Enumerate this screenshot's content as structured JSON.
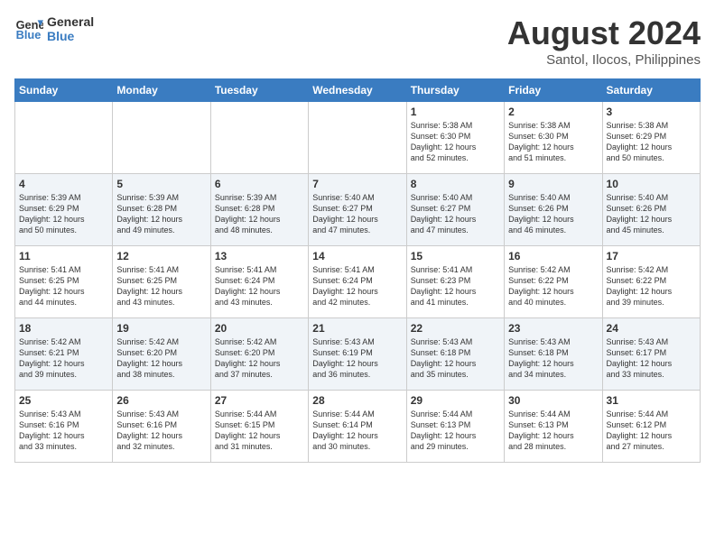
{
  "header": {
    "logo_line1": "General",
    "logo_line2": "Blue",
    "month_year": "August 2024",
    "location": "Santol, Ilocos, Philippines"
  },
  "days_of_week": [
    "Sunday",
    "Monday",
    "Tuesday",
    "Wednesday",
    "Thursday",
    "Friday",
    "Saturday"
  ],
  "weeks": [
    [
      {
        "num": "",
        "detail": ""
      },
      {
        "num": "",
        "detail": ""
      },
      {
        "num": "",
        "detail": ""
      },
      {
        "num": "",
        "detail": ""
      },
      {
        "num": "1",
        "detail": "Sunrise: 5:38 AM\nSunset: 6:30 PM\nDaylight: 12 hours\nand 52 minutes."
      },
      {
        "num": "2",
        "detail": "Sunrise: 5:38 AM\nSunset: 6:30 PM\nDaylight: 12 hours\nand 51 minutes."
      },
      {
        "num": "3",
        "detail": "Sunrise: 5:38 AM\nSunset: 6:29 PM\nDaylight: 12 hours\nand 50 minutes."
      }
    ],
    [
      {
        "num": "4",
        "detail": "Sunrise: 5:39 AM\nSunset: 6:29 PM\nDaylight: 12 hours\nand 50 minutes."
      },
      {
        "num": "5",
        "detail": "Sunrise: 5:39 AM\nSunset: 6:28 PM\nDaylight: 12 hours\nand 49 minutes."
      },
      {
        "num": "6",
        "detail": "Sunrise: 5:39 AM\nSunset: 6:28 PM\nDaylight: 12 hours\nand 48 minutes."
      },
      {
        "num": "7",
        "detail": "Sunrise: 5:40 AM\nSunset: 6:27 PM\nDaylight: 12 hours\nand 47 minutes."
      },
      {
        "num": "8",
        "detail": "Sunrise: 5:40 AM\nSunset: 6:27 PM\nDaylight: 12 hours\nand 47 minutes."
      },
      {
        "num": "9",
        "detail": "Sunrise: 5:40 AM\nSunset: 6:26 PM\nDaylight: 12 hours\nand 46 minutes."
      },
      {
        "num": "10",
        "detail": "Sunrise: 5:40 AM\nSunset: 6:26 PM\nDaylight: 12 hours\nand 45 minutes."
      }
    ],
    [
      {
        "num": "11",
        "detail": "Sunrise: 5:41 AM\nSunset: 6:25 PM\nDaylight: 12 hours\nand 44 minutes."
      },
      {
        "num": "12",
        "detail": "Sunrise: 5:41 AM\nSunset: 6:25 PM\nDaylight: 12 hours\nand 43 minutes."
      },
      {
        "num": "13",
        "detail": "Sunrise: 5:41 AM\nSunset: 6:24 PM\nDaylight: 12 hours\nand 43 minutes."
      },
      {
        "num": "14",
        "detail": "Sunrise: 5:41 AM\nSunset: 6:24 PM\nDaylight: 12 hours\nand 42 minutes."
      },
      {
        "num": "15",
        "detail": "Sunrise: 5:41 AM\nSunset: 6:23 PM\nDaylight: 12 hours\nand 41 minutes."
      },
      {
        "num": "16",
        "detail": "Sunrise: 5:42 AM\nSunset: 6:22 PM\nDaylight: 12 hours\nand 40 minutes."
      },
      {
        "num": "17",
        "detail": "Sunrise: 5:42 AM\nSunset: 6:22 PM\nDaylight: 12 hours\nand 39 minutes."
      }
    ],
    [
      {
        "num": "18",
        "detail": "Sunrise: 5:42 AM\nSunset: 6:21 PM\nDaylight: 12 hours\nand 39 minutes."
      },
      {
        "num": "19",
        "detail": "Sunrise: 5:42 AM\nSunset: 6:20 PM\nDaylight: 12 hours\nand 38 minutes."
      },
      {
        "num": "20",
        "detail": "Sunrise: 5:42 AM\nSunset: 6:20 PM\nDaylight: 12 hours\nand 37 minutes."
      },
      {
        "num": "21",
        "detail": "Sunrise: 5:43 AM\nSunset: 6:19 PM\nDaylight: 12 hours\nand 36 minutes."
      },
      {
        "num": "22",
        "detail": "Sunrise: 5:43 AM\nSunset: 6:18 PM\nDaylight: 12 hours\nand 35 minutes."
      },
      {
        "num": "23",
        "detail": "Sunrise: 5:43 AM\nSunset: 6:18 PM\nDaylight: 12 hours\nand 34 minutes."
      },
      {
        "num": "24",
        "detail": "Sunrise: 5:43 AM\nSunset: 6:17 PM\nDaylight: 12 hours\nand 33 minutes."
      }
    ],
    [
      {
        "num": "25",
        "detail": "Sunrise: 5:43 AM\nSunset: 6:16 PM\nDaylight: 12 hours\nand 33 minutes."
      },
      {
        "num": "26",
        "detail": "Sunrise: 5:43 AM\nSunset: 6:16 PM\nDaylight: 12 hours\nand 32 minutes."
      },
      {
        "num": "27",
        "detail": "Sunrise: 5:44 AM\nSunset: 6:15 PM\nDaylight: 12 hours\nand 31 minutes."
      },
      {
        "num": "28",
        "detail": "Sunrise: 5:44 AM\nSunset: 6:14 PM\nDaylight: 12 hours\nand 30 minutes."
      },
      {
        "num": "29",
        "detail": "Sunrise: 5:44 AM\nSunset: 6:13 PM\nDaylight: 12 hours\nand 29 minutes."
      },
      {
        "num": "30",
        "detail": "Sunrise: 5:44 AM\nSunset: 6:13 PM\nDaylight: 12 hours\nand 28 minutes."
      },
      {
        "num": "31",
        "detail": "Sunrise: 5:44 AM\nSunset: 6:12 PM\nDaylight: 12 hours\nand 27 minutes."
      }
    ]
  ]
}
